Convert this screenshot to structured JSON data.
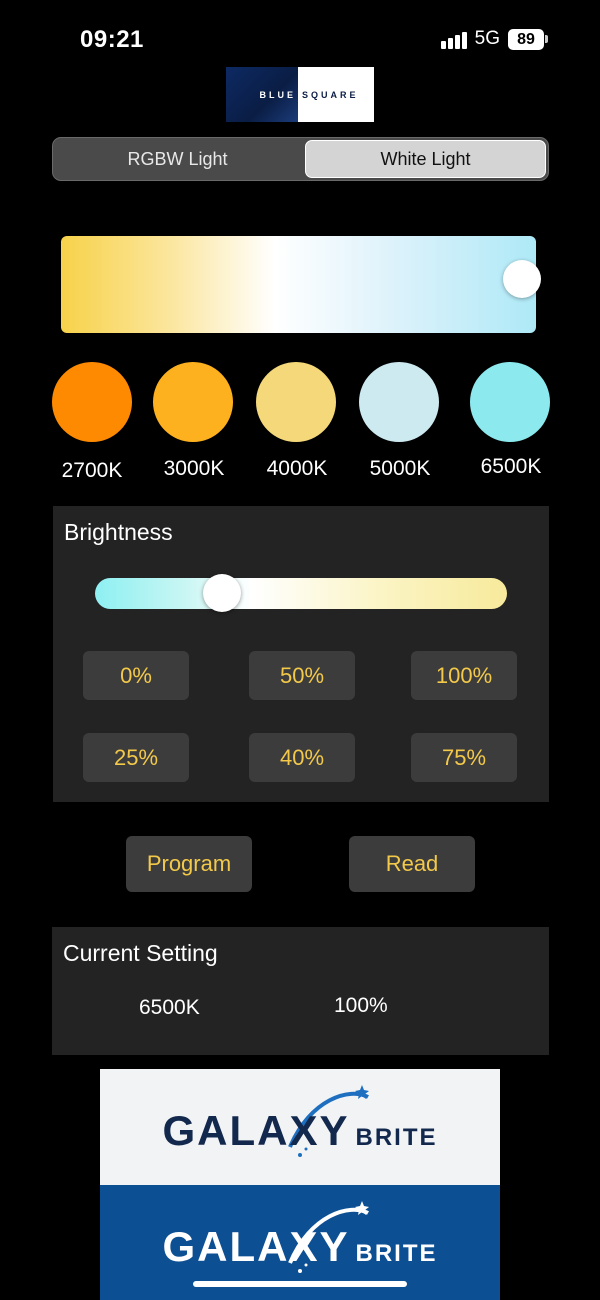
{
  "status": {
    "time": "09:21",
    "network": "5G",
    "battery": "89"
  },
  "brand_logo": {
    "left_text": "BLUE",
    "right_text": "SQUARE"
  },
  "segment": {
    "rgbw_label": "RGBW Light",
    "white_label": "White Light",
    "selected": "White Light"
  },
  "color_temp": {
    "presets": [
      {
        "label": "2700K",
        "color": "#fd8a00"
      },
      {
        "label": "3000K",
        "color": "#fdb11f"
      },
      {
        "label": "4000K",
        "color": "#f4d87a"
      },
      {
        "label": "5000K",
        "color": "#cdeaf0"
      },
      {
        "label": "6500K",
        "color": "#8ceaee"
      }
    ],
    "slider_position_percent": 100
  },
  "brightness": {
    "title": "Brightness",
    "slider_position_percent": 31,
    "buttons": [
      {
        "label": "0%"
      },
      {
        "label": "50%"
      },
      {
        "label": "100%"
      },
      {
        "label": "25%"
      },
      {
        "label": "40%"
      },
      {
        "label": "75%"
      }
    ]
  },
  "actions": {
    "program_label": "Program",
    "read_label": "Read"
  },
  "current_setting": {
    "title": "Current Setting",
    "temperature": "6500K",
    "brightness": "100%"
  },
  "footer_logo": {
    "word": "GALAXY",
    "sub": "BRITE"
  },
  "colors": {
    "accent_text": "#f3c94a",
    "panel_bg": "#232323",
    "button_bg": "#3c3c3c"
  }
}
